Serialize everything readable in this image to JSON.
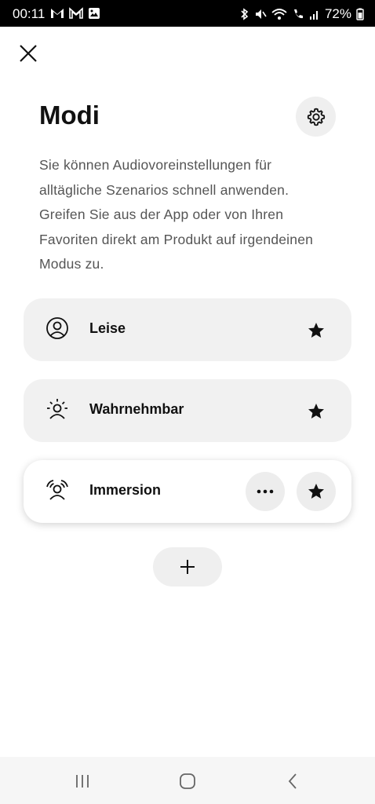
{
  "status_bar": {
    "time": "00:11",
    "battery": "72%",
    "notif_icons": [
      "gmail-icon",
      "gmail-icon",
      "image-icon"
    ],
    "sys_icons": [
      "bluetooth-icon",
      "mute-icon",
      "wifi-call-icon",
      "call-icon",
      "signal-icon",
      "battery-icon"
    ]
  },
  "header": {
    "title": "Modi",
    "description": "Sie können Audiovoreinstellungen für alltägliche Szenarios schnell anwenden. Greifen Sie aus der App oder von Ihren Favoriten direkt am Produkt auf irgendeinen Modus zu."
  },
  "modes": [
    {
      "label": "Leise",
      "icon": "quiet-mode-icon",
      "favorite": true,
      "selected": false
    },
    {
      "label": "Wahrnehmbar",
      "icon": "aware-mode-icon",
      "favorite": true,
      "selected": false
    },
    {
      "label": "Immersion",
      "icon": "immersion-mode-icon",
      "favorite": true,
      "selected": true
    }
  ],
  "colors": {
    "card_bg": "#f1f1f1",
    "button_bg": "#efefef",
    "text": "#111111",
    "description": "#555555"
  }
}
